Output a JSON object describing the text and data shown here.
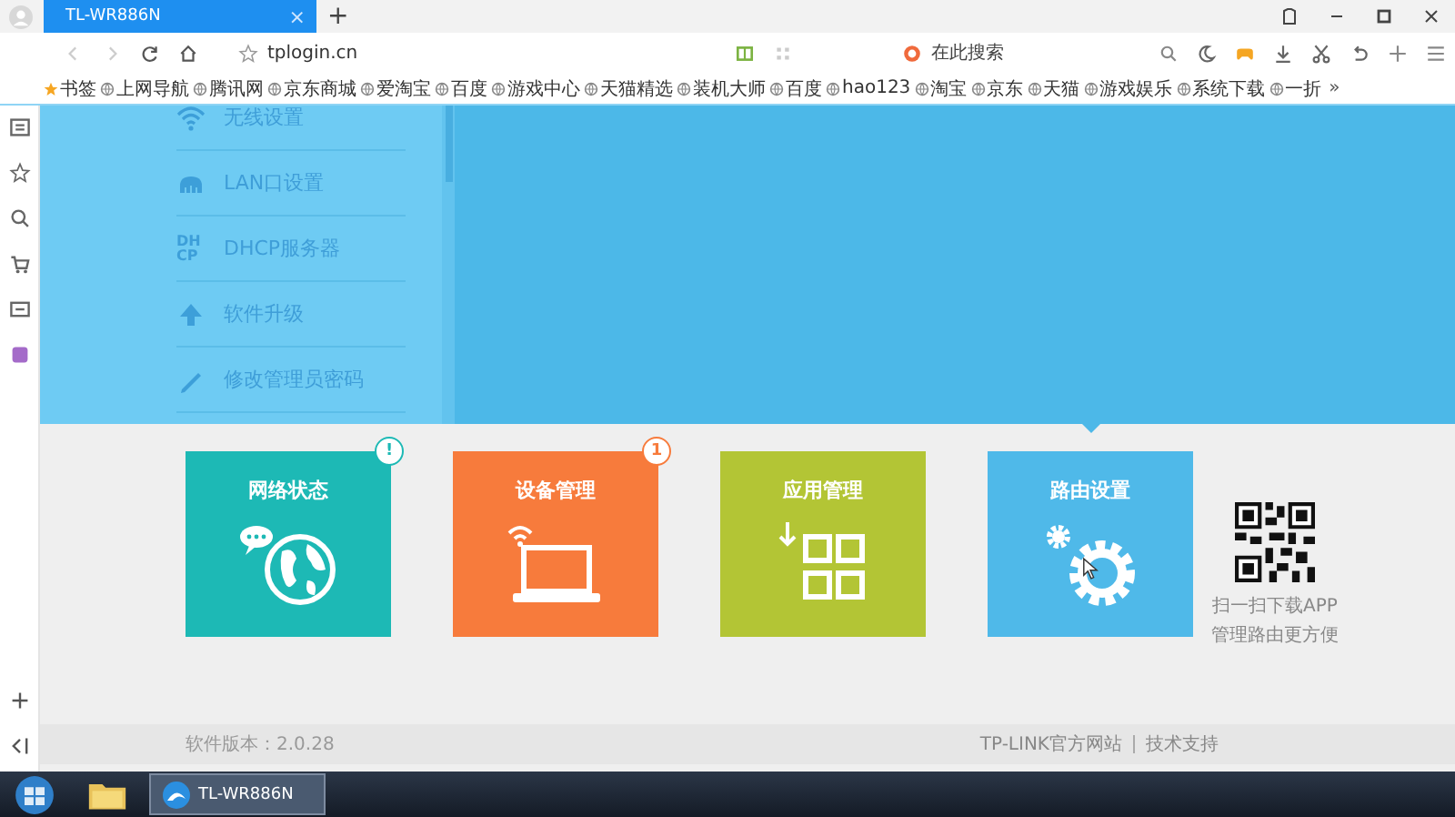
{
  "browser": {
    "tab_title": "TL-WR886N",
    "tab_close": "×",
    "new_tab": "+",
    "url": "tplogin.cn",
    "search_placeholder": "在此搜索"
  },
  "bookmarks": [
    {
      "label": "书签",
      "kind": "star"
    },
    {
      "label": "上网导航",
      "kind": "site"
    },
    {
      "label": "腾讯网",
      "kind": "site"
    },
    {
      "label": "京东商城",
      "kind": "site"
    },
    {
      "label": "爱淘宝",
      "kind": "site"
    },
    {
      "label": "百度",
      "kind": "site"
    },
    {
      "label": "游戏中心",
      "kind": "site"
    },
    {
      "label": "天猫精选",
      "kind": "site"
    },
    {
      "label": "装机大师",
      "kind": "site"
    },
    {
      "label": "百度",
      "kind": "site"
    },
    {
      "label": "hao123",
      "kind": "site"
    },
    {
      "label": "淘宝",
      "kind": "site"
    },
    {
      "label": "京东",
      "kind": "site"
    },
    {
      "label": "天猫",
      "kind": "site"
    },
    {
      "label": "游戏娱乐",
      "kind": "site"
    },
    {
      "label": "系统下载",
      "kind": "site"
    },
    {
      "label": "一折",
      "kind": "site"
    }
  ],
  "bookmarks_more": "»",
  "router": {
    "menu": [
      {
        "label": "无线设置",
        "kind": "wifi"
      },
      {
        "label": "LAN口设置",
        "kind": "lan"
      },
      {
        "label": "DHCP服务器",
        "kind": "dhcp",
        "icon_text": [
          "DH",
          "CP"
        ]
      },
      {
        "label": "软件升级",
        "kind": "upgrade"
      },
      {
        "label": "修改管理员密码",
        "kind": "password"
      }
    ],
    "tiles": [
      {
        "title": "网络状态",
        "color": "#1db9b5",
        "kind": "globe",
        "badge": "!",
        "selected": false
      },
      {
        "title": "设备管理",
        "color": "#f77b3c",
        "kind": "laptop",
        "badge": "1",
        "selected": false
      },
      {
        "title": "应用管理",
        "color": "#b3c535",
        "kind": "apps",
        "selected": false
      },
      {
        "title": "路由设置",
        "color": "#4fb9e9",
        "kind": "gear",
        "selected": true
      }
    ],
    "app_qr": {
      "lines": [
        "扫一扫下载APP",
        "管理路由更方便"
      ]
    },
    "footer": {
      "version": "软件版本：2.0.28",
      "links": [
        "TP-LINK官方网站",
        "技术支持"
      ]
    }
  },
  "taskbar": {
    "window": "TL-WR886N"
  }
}
